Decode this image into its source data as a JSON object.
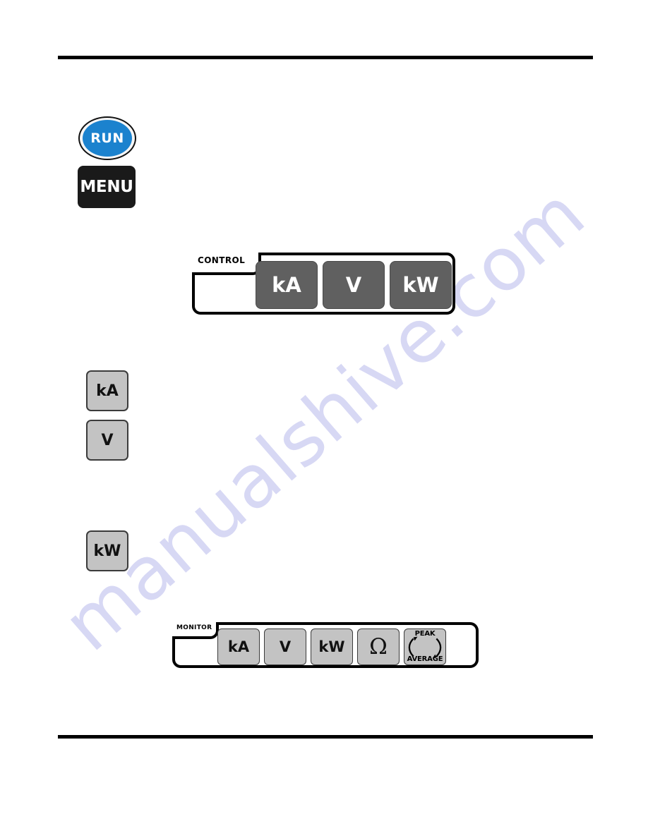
{
  "page": {
    "background_color": "#ffffff",
    "rule_color": "#000000"
  },
  "watermark": {
    "text": "manualshive.com",
    "color": "#c9caf0"
  },
  "figures": {
    "run_button": {
      "label": "RUN",
      "face_color": "#1b82ce",
      "text_color": "#ffffff",
      "icon": "run-oval-button"
    },
    "menu_button": {
      "label": "MENU",
      "face_color": "#1a1a1a",
      "text_color": "#ffffff",
      "icon": "menu-key"
    },
    "standalone_keys": [
      {
        "label": "kA",
        "face_color": "#c3c3c3",
        "text_color": "#111111"
      },
      {
        "label": "V",
        "face_color": "#c3c3c3",
        "text_color": "#111111"
      },
      {
        "label": "kW",
        "face_color": "#c3c3c3",
        "text_color": "#111111"
      }
    ],
    "control_panel": {
      "tab_label": "CONTROL",
      "key_face_color": "#606060",
      "key_text_color": "#ffffff",
      "keys": [
        {
          "label": "kA"
        },
        {
          "label": "V"
        },
        {
          "label": "kW"
        }
      ]
    },
    "monitor_panel": {
      "tab_label": "MONITOR",
      "key_face_color": "#c3c3c3",
      "key_text_color": "#111111",
      "keys": [
        {
          "label": "kA",
          "icon": "ka-key"
        },
        {
          "label": "V",
          "icon": "v-key"
        },
        {
          "label": "kW",
          "icon": "kw-key"
        },
        {
          "label": "Ω",
          "icon": "omega-key"
        }
      ],
      "cycle_key": {
        "top_label": "PEAK",
        "bottom_label": "AVERAGE",
        "icon": "cycle-arrows-icon"
      }
    }
  }
}
